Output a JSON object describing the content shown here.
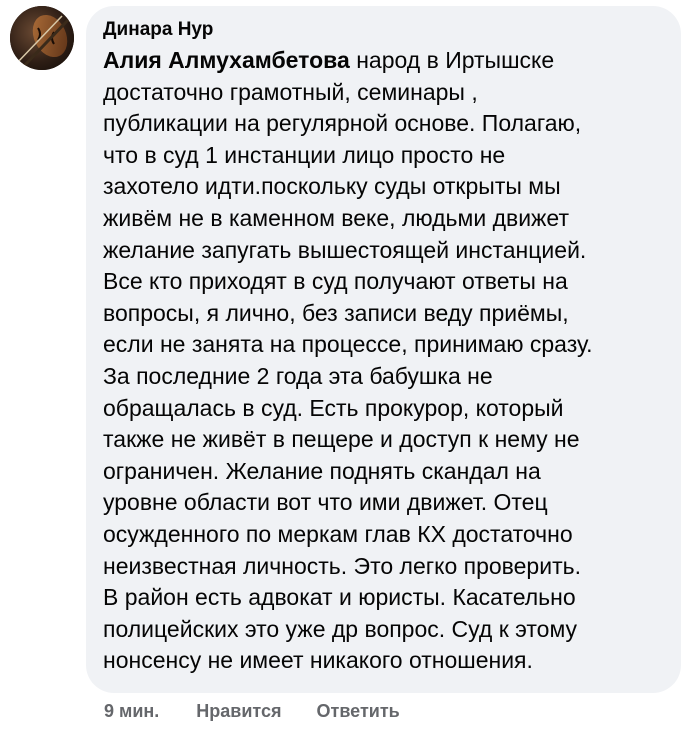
{
  "comment": {
    "author": "Динара Нур",
    "mention": "Алия Алмухамбетова",
    "lines": [
      " народ в Иртышске",
      "достаточно грамотный, семинары ,",
      "публикации на регулярной основе. Полагаю,",
      "что в суд 1 инстанции лицо просто не",
      "захотело идти.поскольку суды открыты мы",
      "живём не в каменном веке, людьми движет",
      "желание запугать вышестоящей инстанцией.",
      "Все кто приходят в суд получают ответы на",
      "вопросы, я лично, без записи веду приёмы,",
      "если не занята на процессе, принимаю сразу.",
      "За последние 2 года эта бабушка не",
      "обращалась в суд. Есть прокурор, который",
      "также не живёт в пещере и доступ к нему не",
      "ограничен. Желание поднять скандал на",
      "уровне области вот что ими движет. Отец",
      "осужденного по меркам глав КХ достаточно",
      "неизвестная личность. Это легко проверить.",
      "В район есть адвокат и юристы. Касательно",
      "полицейских это уже др вопрос. Суд к этому",
      "нонсенсу не имеет никакого отношения."
    ],
    "time": "9 мин.",
    "like_label": "Нравится",
    "reply_label": "Ответить"
  },
  "colors": {
    "bubble_background": "#f0f2f5",
    "text": "#050505",
    "meta_text": "#65676b"
  },
  "icons": {
    "avatar": "profile-photo-violin"
  }
}
